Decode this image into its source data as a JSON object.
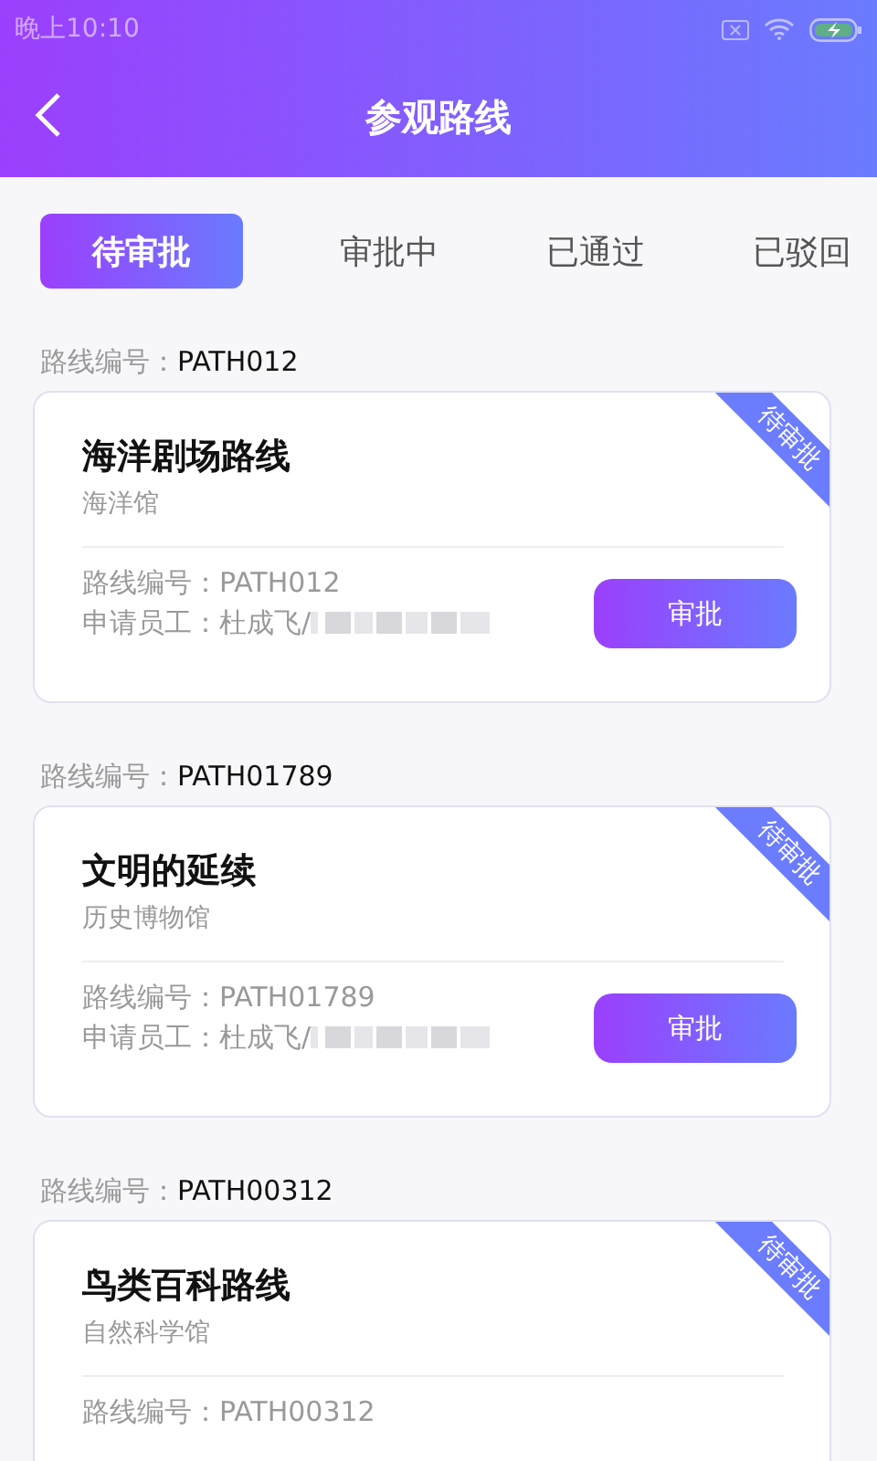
{
  "status_bar": {
    "time": "晚上10:10"
  },
  "header": {
    "title": "参观路线"
  },
  "tabs": [
    {
      "label": "待审批",
      "selected": true
    },
    {
      "label": "审批中",
      "selected": false
    },
    {
      "label": "已通过",
      "selected": false
    },
    {
      "label": "已驳回",
      "selected": false
    }
  ],
  "routes": [
    {
      "group_label": "路线编号：",
      "group_code": "PATH012",
      "title": "海洋剧场路线",
      "venue": "海洋馆",
      "ribbon": "待审批",
      "code_line": "路线编号：PATH012",
      "applicant": "申请员工：杜成飞/",
      "action": "审批"
    },
    {
      "group_label": "路线编号：",
      "group_code": "PATH01789",
      "title": "文明的延续",
      "venue": "历史博物馆",
      "ribbon": "待审批",
      "code_line": "路线编号：PATH01789",
      "applicant": "申请员工：杜成飞/",
      "action": "审批"
    },
    {
      "group_label": "路线编号：",
      "group_code": "PATH00312",
      "title": "鸟类百科路线",
      "venue": "自然科学馆",
      "ribbon": "待审批",
      "code_line": "路线编号：PATH00312"
    }
  ]
}
